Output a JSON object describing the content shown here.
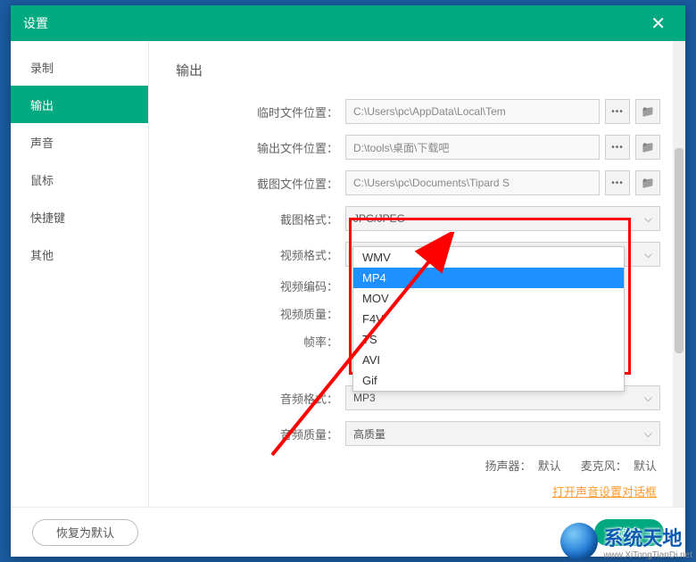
{
  "titlebar": {
    "title": "设置"
  },
  "sidebar": {
    "items": [
      {
        "label": "录制"
      },
      {
        "label": "输出"
      },
      {
        "label": "声音"
      },
      {
        "label": "鼠标"
      },
      {
        "label": "快捷键"
      },
      {
        "label": "其他"
      }
    ],
    "active_index": 1
  },
  "output": {
    "title": "输出",
    "temp_label": "临时文件位置：",
    "temp_value": "C:\\Users\\pc\\AppData\\Local\\Tem",
    "out_label": "输出文件位置：",
    "out_value": "D:\\tools\\桌面\\下载吧",
    "screenshot_label": "截图文件位置：",
    "screenshot_value": "C:\\Users\\pc\\Documents\\Tipard S",
    "screenshot_fmt_label": "截图格式：",
    "screenshot_fmt_value": "JPG/JPEG",
    "video_fmt_label": "视频格式：",
    "video_fmt_value": "MP4",
    "video_enc_label": "视频编码：",
    "video_quality_label": "视频质量：",
    "fps_label": "帧率：",
    "audio_fmt_label": "音频格式：",
    "audio_fmt_value": "MP3",
    "audio_quality_label": "音频质量：",
    "audio_quality_value": "高质量",
    "speaker_label": "扬声器：",
    "speaker_value": "默认",
    "mic_label": "麦克风：",
    "mic_value": "默认",
    "sound_link": "打开声音设置对话框"
  },
  "dropdown": {
    "options": [
      "WMV",
      "MP4",
      "MOV",
      "F4V",
      "TS",
      "AVI",
      "Gif"
    ],
    "selected_index": 1
  },
  "sound": {
    "title": "声音"
  },
  "footer": {
    "restore": "恢复为默认",
    "ok": "确定"
  },
  "watermark": {
    "text": "系统天地",
    "url": "www.XiTongTianDi.net"
  }
}
